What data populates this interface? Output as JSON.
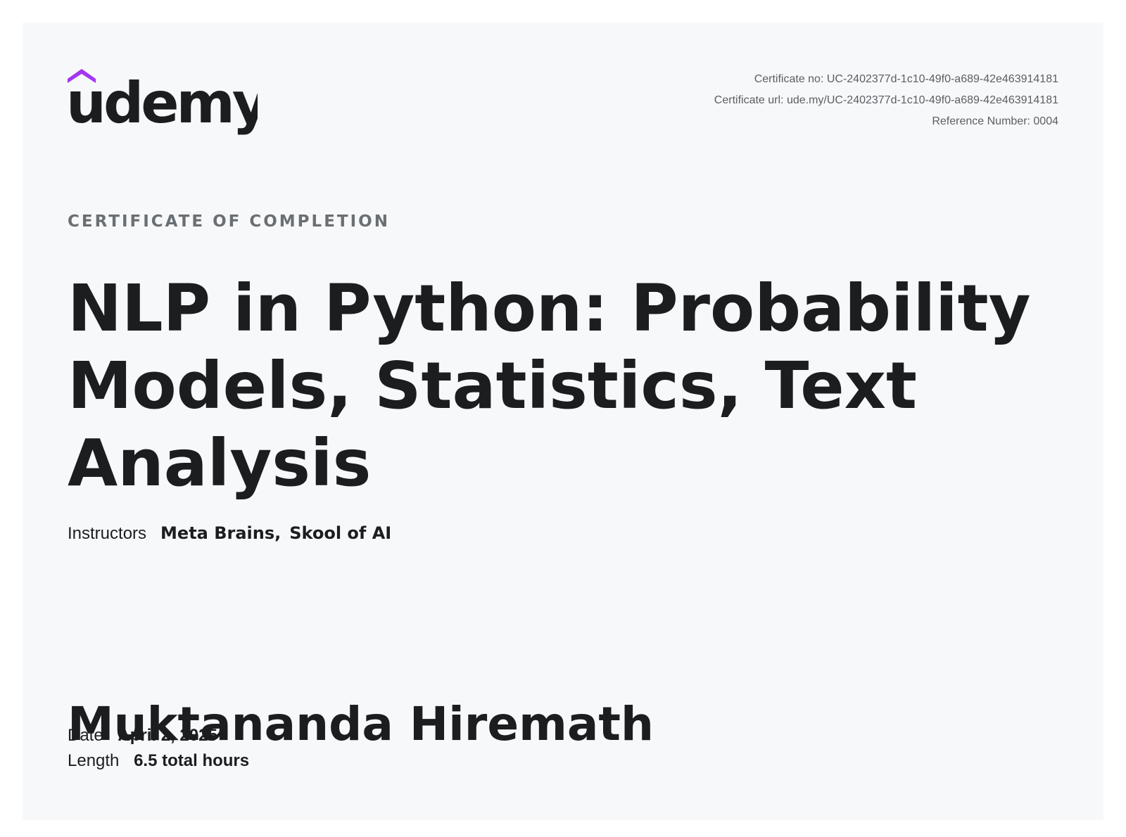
{
  "brand": {
    "name": "udemy",
    "accent_color": "#a435f0"
  },
  "certificate": {
    "number_line": "Certificate no: UC-2402377d-1c10-49f0-a689-42e463914181",
    "url_line": "Certificate url: ude.my/UC-2402377d-1c10-49f0-a689-42e463914181",
    "reference_line": "Reference Number: 0004",
    "kicker": "CERTIFICATE OF COMPLETION"
  },
  "course": {
    "title": "NLP in Python: Probability Models, Statistics, Text Analysis"
  },
  "instructors": {
    "label": "Instructors",
    "names": [
      "Meta Brains,",
      "Skool of AI"
    ]
  },
  "recipient": {
    "name": "Muktananda Hiremath"
  },
  "details": {
    "date_label": "Date",
    "date_value": "April 2, 2025",
    "length_label": "Length",
    "length_value": "6.5 total hours"
  }
}
